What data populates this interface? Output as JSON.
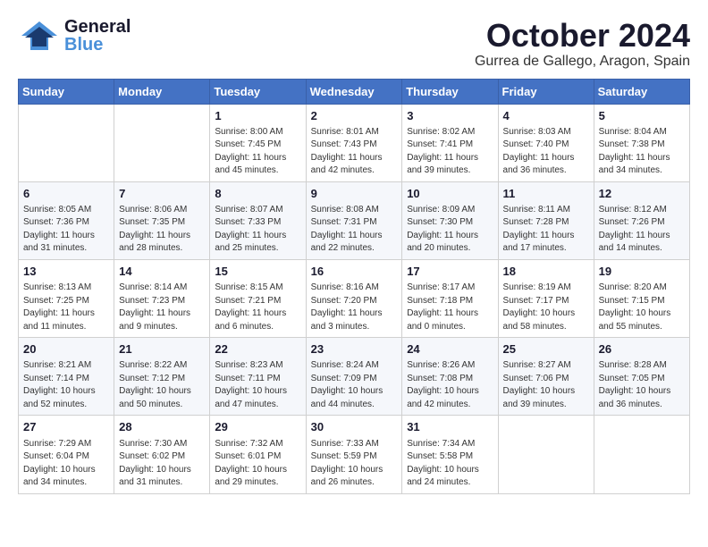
{
  "header": {
    "logo": {
      "general": "General",
      "blue": "Blue"
    },
    "title": "October 2024",
    "location": "Gurrea de Gallego, Aragon, Spain"
  },
  "days_of_week": [
    "Sunday",
    "Monday",
    "Tuesday",
    "Wednesday",
    "Thursday",
    "Friday",
    "Saturday"
  ],
  "weeks": [
    [
      {
        "day": "",
        "info": ""
      },
      {
        "day": "",
        "info": ""
      },
      {
        "day": "1",
        "info": "Sunrise: 8:00 AM\nSunset: 7:45 PM\nDaylight: 11 hours and 45 minutes."
      },
      {
        "day": "2",
        "info": "Sunrise: 8:01 AM\nSunset: 7:43 PM\nDaylight: 11 hours and 42 minutes."
      },
      {
        "day": "3",
        "info": "Sunrise: 8:02 AM\nSunset: 7:41 PM\nDaylight: 11 hours and 39 minutes."
      },
      {
        "day": "4",
        "info": "Sunrise: 8:03 AM\nSunset: 7:40 PM\nDaylight: 11 hours and 36 minutes."
      },
      {
        "day": "5",
        "info": "Sunrise: 8:04 AM\nSunset: 7:38 PM\nDaylight: 11 hours and 34 minutes."
      }
    ],
    [
      {
        "day": "6",
        "info": "Sunrise: 8:05 AM\nSunset: 7:36 PM\nDaylight: 11 hours and 31 minutes."
      },
      {
        "day": "7",
        "info": "Sunrise: 8:06 AM\nSunset: 7:35 PM\nDaylight: 11 hours and 28 minutes."
      },
      {
        "day": "8",
        "info": "Sunrise: 8:07 AM\nSunset: 7:33 PM\nDaylight: 11 hours and 25 minutes."
      },
      {
        "day": "9",
        "info": "Sunrise: 8:08 AM\nSunset: 7:31 PM\nDaylight: 11 hours and 22 minutes."
      },
      {
        "day": "10",
        "info": "Sunrise: 8:09 AM\nSunset: 7:30 PM\nDaylight: 11 hours and 20 minutes."
      },
      {
        "day": "11",
        "info": "Sunrise: 8:11 AM\nSunset: 7:28 PM\nDaylight: 11 hours and 17 minutes."
      },
      {
        "day": "12",
        "info": "Sunrise: 8:12 AM\nSunset: 7:26 PM\nDaylight: 11 hours and 14 minutes."
      }
    ],
    [
      {
        "day": "13",
        "info": "Sunrise: 8:13 AM\nSunset: 7:25 PM\nDaylight: 11 hours and 11 minutes."
      },
      {
        "day": "14",
        "info": "Sunrise: 8:14 AM\nSunset: 7:23 PM\nDaylight: 11 hours and 9 minutes."
      },
      {
        "day": "15",
        "info": "Sunrise: 8:15 AM\nSunset: 7:21 PM\nDaylight: 11 hours and 6 minutes."
      },
      {
        "day": "16",
        "info": "Sunrise: 8:16 AM\nSunset: 7:20 PM\nDaylight: 11 hours and 3 minutes."
      },
      {
        "day": "17",
        "info": "Sunrise: 8:17 AM\nSunset: 7:18 PM\nDaylight: 11 hours and 0 minutes."
      },
      {
        "day": "18",
        "info": "Sunrise: 8:19 AM\nSunset: 7:17 PM\nDaylight: 10 hours and 58 minutes."
      },
      {
        "day": "19",
        "info": "Sunrise: 8:20 AM\nSunset: 7:15 PM\nDaylight: 10 hours and 55 minutes."
      }
    ],
    [
      {
        "day": "20",
        "info": "Sunrise: 8:21 AM\nSunset: 7:14 PM\nDaylight: 10 hours and 52 minutes."
      },
      {
        "day": "21",
        "info": "Sunrise: 8:22 AM\nSunset: 7:12 PM\nDaylight: 10 hours and 50 minutes."
      },
      {
        "day": "22",
        "info": "Sunrise: 8:23 AM\nSunset: 7:11 PM\nDaylight: 10 hours and 47 minutes."
      },
      {
        "day": "23",
        "info": "Sunrise: 8:24 AM\nSunset: 7:09 PM\nDaylight: 10 hours and 44 minutes."
      },
      {
        "day": "24",
        "info": "Sunrise: 8:26 AM\nSunset: 7:08 PM\nDaylight: 10 hours and 42 minutes."
      },
      {
        "day": "25",
        "info": "Sunrise: 8:27 AM\nSunset: 7:06 PM\nDaylight: 10 hours and 39 minutes."
      },
      {
        "day": "26",
        "info": "Sunrise: 8:28 AM\nSunset: 7:05 PM\nDaylight: 10 hours and 36 minutes."
      }
    ],
    [
      {
        "day": "27",
        "info": "Sunrise: 7:29 AM\nSunset: 6:04 PM\nDaylight: 10 hours and 34 minutes."
      },
      {
        "day": "28",
        "info": "Sunrise: 7:30 AM\nSunset: 6:02 PM\nDaylight: 10 hours and 31 minutes."
      },
      {
        "day": "29",
        "info": "Sunrise: 7:32 AM\nSunset: 6:01 PM\nDaylight: 10 hours and 29 minutes."
      },
      {
        "day": "30",
        "info": "Sunrise: 7:33 AM\nSunset: 5:59 PM\nDaylight: 10 hours and 26 minutes."
      },
      {
        "day": "31",
        "info": "Sunrise: 7:34 AM\nSunset: 5:58 PM\nDaylight: 10 hours and 24 minutes."
      },
      {
        "day": "",
        "info": ""
      },
      {
        "day": "",
        "info": ""
      }
    ]
  ]
}
